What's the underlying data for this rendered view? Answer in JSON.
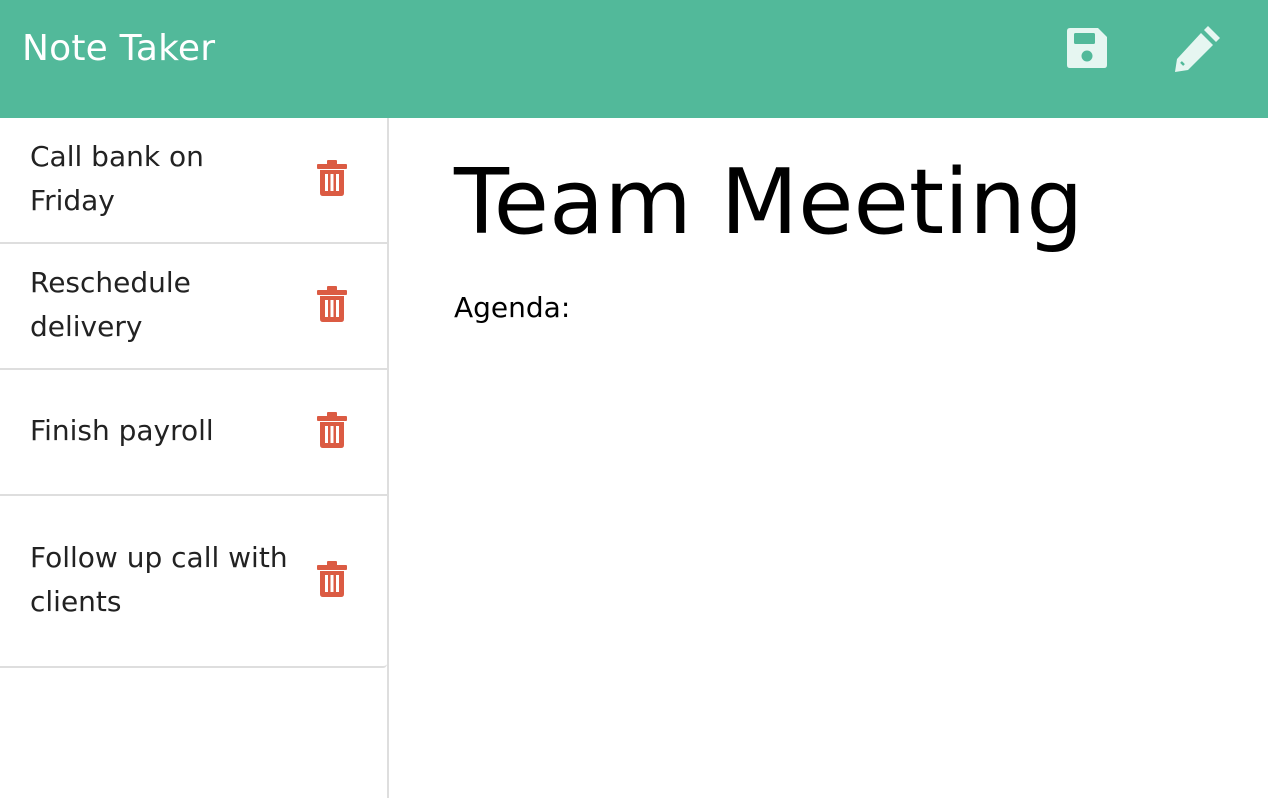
{
  "app": {
    "title": "Note Taker"
  },
  "toolbar": {
    "save_icon": "save-icon",
    "edit_icon": "pencil-icon"
  },
  "sidebar": {
    "notes": [
      {
        "title": "Call bank on Friday"
      },
      {
        "title": "Reschedule delivery"
      },
      {
        "title": "Finish payroll"
      },
      {
        "title": "Follow up call with clients"
      }
    ],
    "delete_icon": "trash-icon"
  },
  "main": {
    "note_title": "Team Meeting",
    "note_text": "Agenda:"
  },
  "colors": {
    "navbar": "#52b99a",
    "icon_light": "#e6f6f1",
    "delete": "#db5b43",
    "divider": "#dedede"
  }
}
